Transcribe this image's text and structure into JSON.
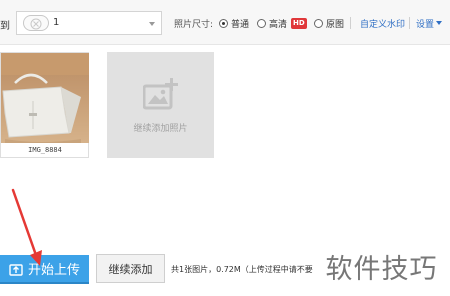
{
  "toolbar": {
    "to_label": "到",
    "album_value": "1",
    "size_label": "照片尺寸:",
    "size_options": [
      "普通",
      "高清",
      "原图"
    ],
    "hd_badge": "HD",
    "custom_watermark": "自定义水印",
    "settings": "设置",
    "colors": {
      "link": "#2f6fc4",
      "badge": "#e0373a"
    }
  },
  "photos": [
    {
      "name": "IMG_8884"
    }
  ],
  "add_tile": {
    "label": "继续添加照片",
    "icon": "image-plus-icon"
  },
  "actions": {
    "upload_label": "开始上传",
    "continue_label": "继续添加",
    "status": "共1张图片，0.72M（上传过程中请不要"
  },
  "watermark": "软件技巧",
  "colors": {
    "upload_button": "#3ca2e8",
    "arrow": "#e53935"
  }
}
